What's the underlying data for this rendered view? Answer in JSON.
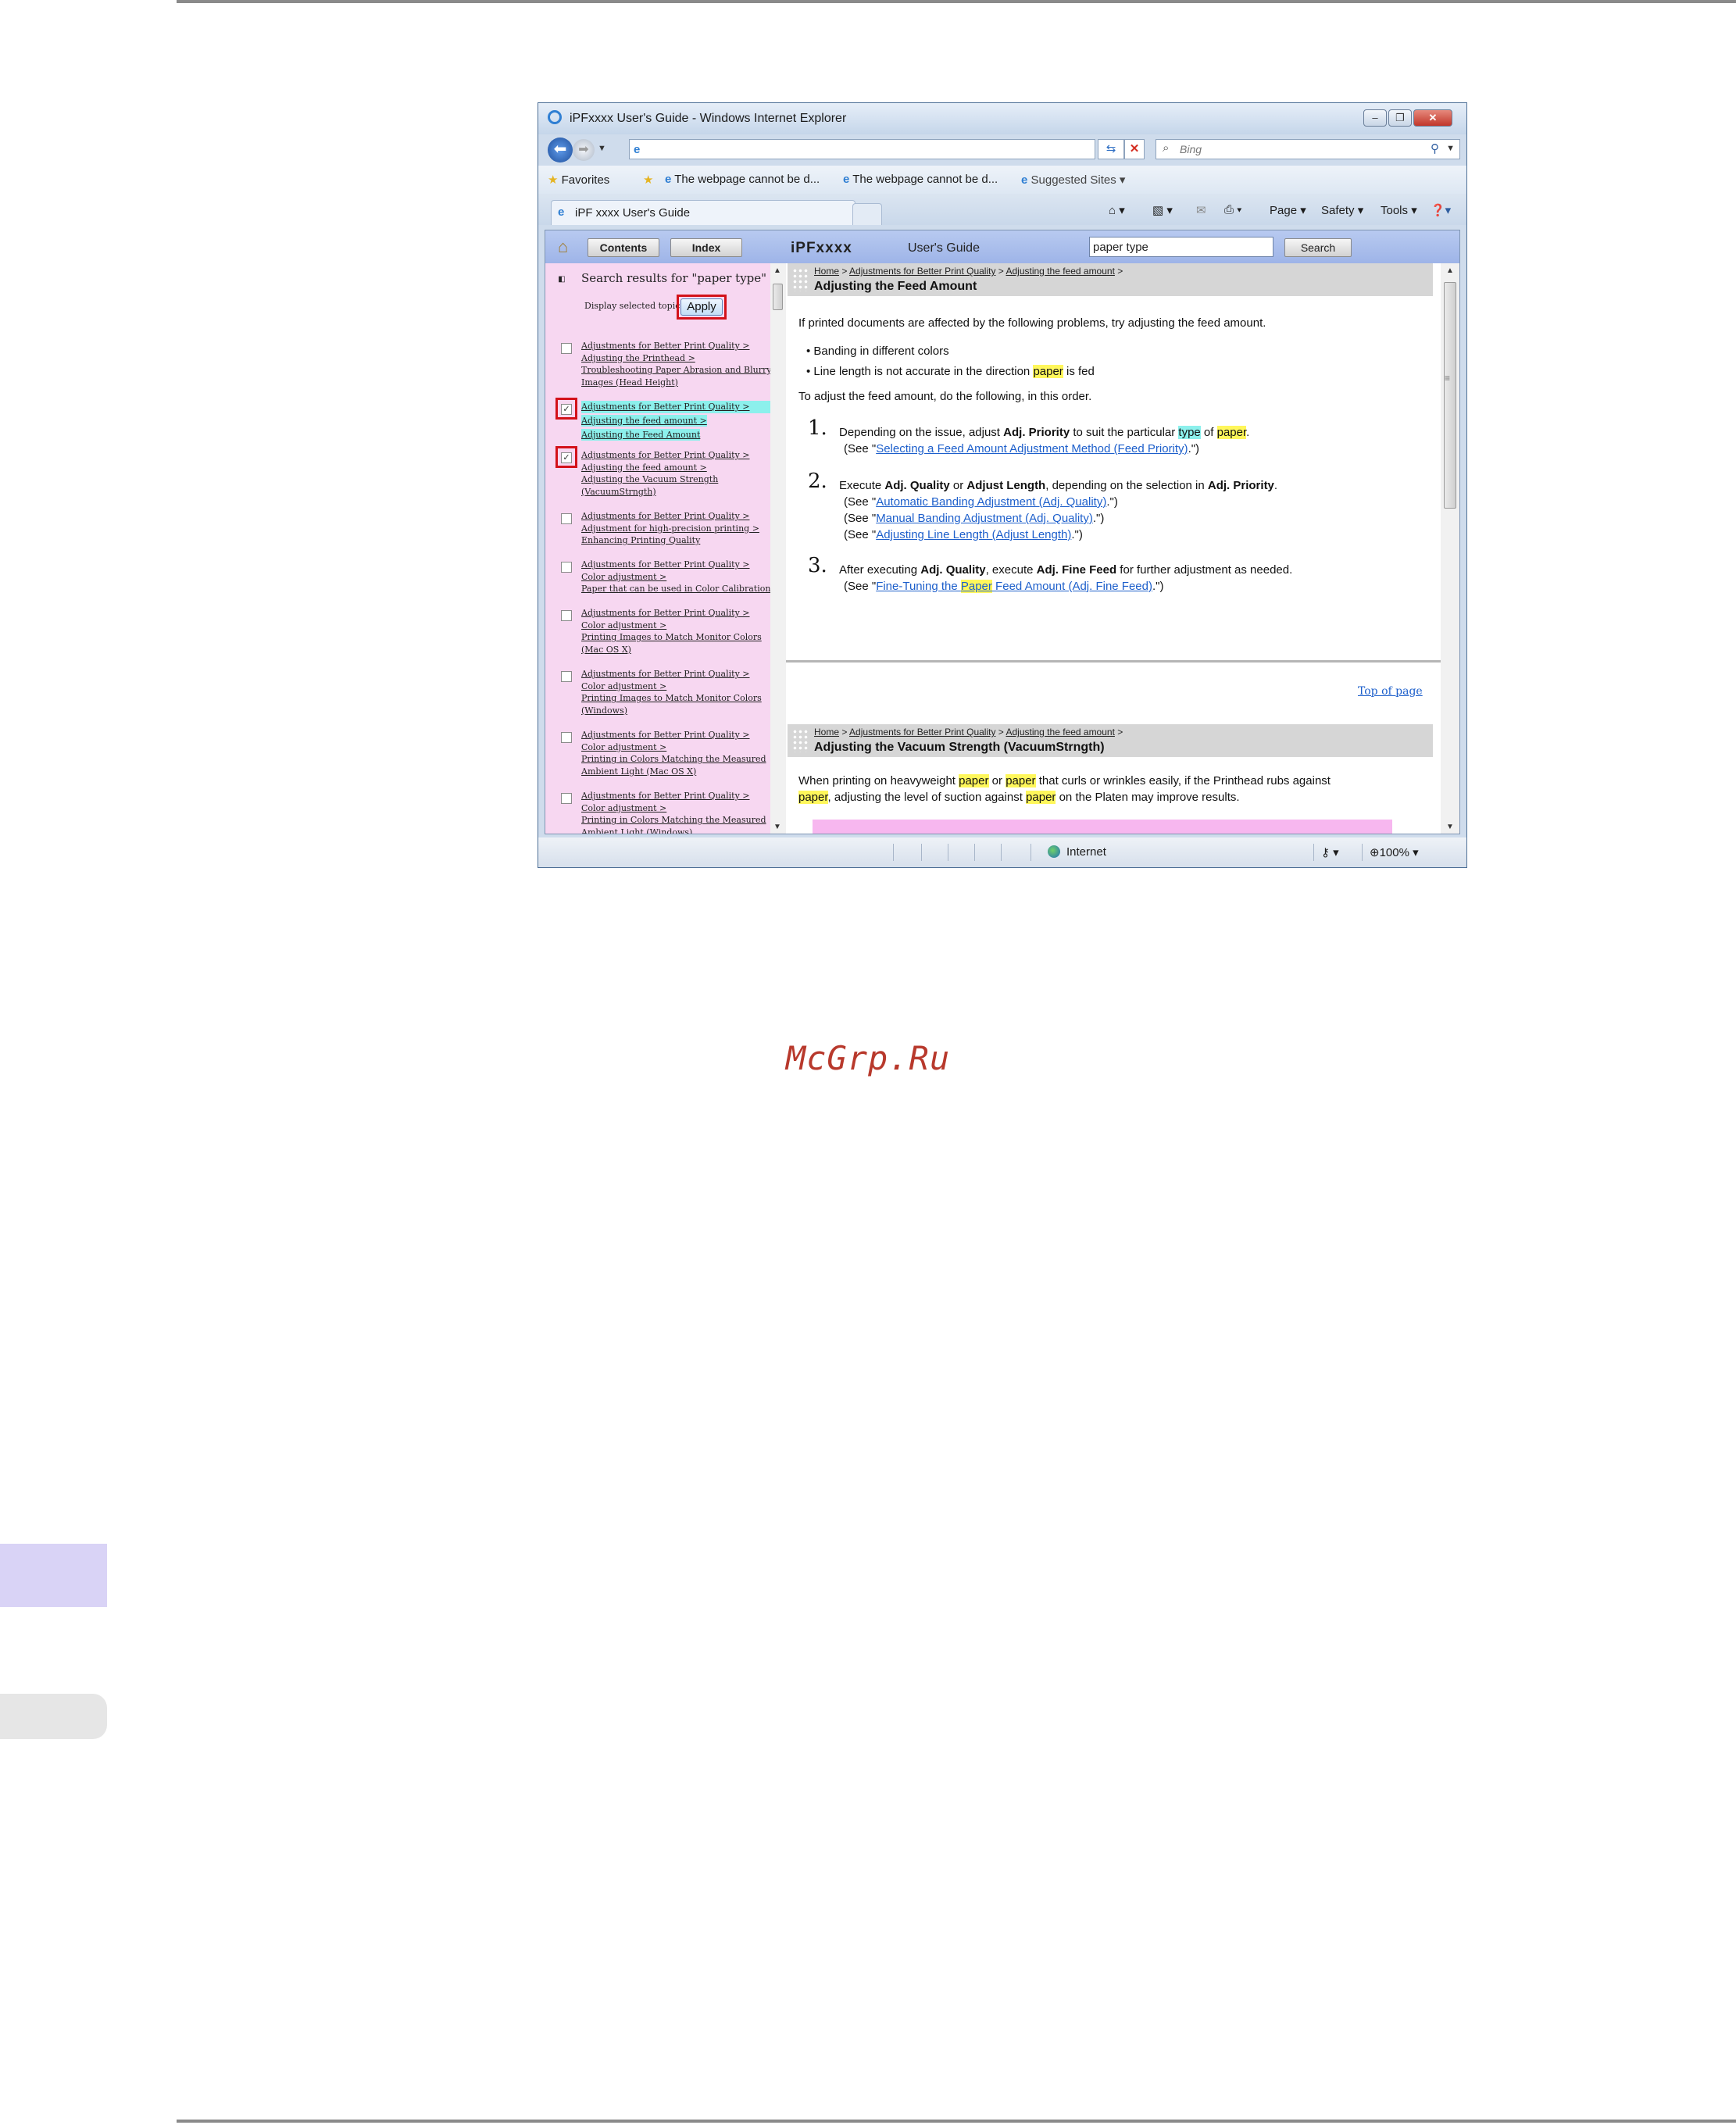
{
  "window": {
    "title": "iPFxxxx  User's Guide - Windows Internet Explorer",
    "search_placeholder": "Bing"
  },
  "favorites_bar": {
    "favorites_label": "Favorites",
    "items": [
      "The webpage cannot be d...",
      "The webpage cannot be d...",
      "Suggested Sites"
    ]
  },
  "tab": {
    "label": "iPF xxxx  User's Guide"
  },
  "command_bar": {
    "page": "Page",
    "safety": "Safety",
    "tools": "Tools"
  },
  "app": {
    "contents_button": "Contents",
    "index_button": "Index",
    "brand": "iPFxxxx",
    "guide_title": "User's Guide",
    "search_value": "paper type",
    "search_button": "Search"
  },
  "search_panel": {
    "heading": "Search results for \"paper type\"",
    "display_selected": "Display selected topic",
    "apply_button": "Apply",
    "results": [
      {
        "checked": false,
        "selected": false,
        "lines": [
          "Adjustments for Better Print Quality >",
          "Adjusting the Printhead >",
          "Troubleshooting Paper Abrasion and Blurry",
          "Images (Head Height)"
        ]
      },
      {
        "checked": true,
        "selected": true,
        "lines": [
          "Adjustments for Better Print Quality >",
          "Adjusting the feed amount >",
          "Adjusting the Feed Amount"
        ]
      },
      {
        "checked": true,
        "selected": false,
        "lines": [
          "Adjustments for Better Print Quality >",
          "Adjusting the feed amount >",
          "Adjusting the Vacuum Strength",
          "(VacuumStrngth)"
        ]
      },
      {
        "checked": false,
        "selected": false,
        "lines": [
          "Adjustments for Better Print Quality >",
          "Adjustment for high-precision printing >",
          "Enhancing Printing Quality"
        ]
      },
      {
        "checked": false,
        "selected": false,
        "lines": [
          "Adjustments for Better Print Quality >",
          "Color adjustment >",
          "Paper that can be used in Color Calibration"
        ]
      },
      {
        "checked": false,
        "selected": false,
        "lines": [
          "Adjustments for Better Print Quality >",
          "Color adjustment >",
          "Printing Images to Match Monitor Colors",
          "(Mac OS X)"
        ]
      },
      {
        "checked": false,
        "selected": false,
        "lines": [
          "Adjustments for Better Print Quality >",
          "Color adjustment >",
          "Printing Images to Match Monitor Colors",
          "(Windows)"
        ]
      },
      {
        "checked": false,
        "selected": false,
        "lines": [
          "Adjustments for Better Print Quality >",
          "Color adjustment >",
          "Printing in Colors Matching the Measured",
          "Ambient Light (Mac OS X)"
        ]
      },
      {
        "checked": false,
        "selected": false,
        "lines": [
          "Adjustments for Better Print Quality >",
          "Color adjustment >",
          "Printing in Colors Matching the Measured",
          "Ambient Light (Windows)"
        ]
      }
    ]
  },
  "section1": {
    "crumb_home": "Home",
    "crumb_sep": ">",
    "crumb_1": "Adjustments for Better Print Quality",
    "crumb_2": "Adjusting the feed amount",
    "title": "Adjusting the Feed Amount",
    "intro": "If printed documents are affected by the following problems, try adjusting the feed amount.",
    "bullet1": "Banding in different colors",
    "bullet2_a": "Line length is not accurate in the direction ",
    "bullet2_hl": "paper",
    "bullet2_b": " is fed",
    "order": "To adjust the feed amount, do the following, in this order.",
    "step1_num": "1.",
    "step1_a": "Depending on the issue, adjust ",
    "step1_b": "Adj. Priority",
    "step1_c": " to suit the particular ",
    "step1_hl1": "type",
    "step1_d": " of ",
    "step1_hl2": "paper",
    "step1_e": ".",
    "see_open": "(See \"",
    "see_close": ".\")",
    "step1_link": "Selecting a Feed Amount Adjustment Method (Feed Priority)",
    "step2_num": "2.",
    "step2_a": "Execute ",
    "step2_b": "Adj. Quality",
    "step2_c": " or ",
    "step2_d": "Adjust Length",
    "step2_e": ", depending on the selection in ",
    "step2_f": "Adj. Priority",
    "step2_g": ".",
    "step2_link1": "Automatic Banding Adjustment (Adj. Quality)",
    "step2_link2": "Manual Banding Adjustment (Adj. Quality)",
    "step2_link3": "Adjusting Line Length (Adjust Length)",
    "step3_num": "3.",
    "step3_a": "After executing ",
    "step3_b": "Adj. Quality",
    "step3_c": ", execute ",
    "step3_d": "Adj. Fine Feed",
    "step3_e": " for further adjustment as needed.",
    "step3_link_a": "Fine-Tuning the ",
    "step3_link_hl": "Paper",
    "step3_link_b": " Feed Amount (Adj. Fine Feed)",
    "top_of_page": "Top of page"
  },
  "section2": {
    "title": "Adjusting the Vacuum Strength (VacuumStrngth)",
    "l1_a": "When printing on heavyweight ",
    "l1_hl1": "paper",
    "l1_b": " or ",
    "l1_hl2": "paper",
    "l1_c": " that curls or wrinkles easily, if the Printhead rubs against",
    "l2_hl1": "paper",
    "l2_a": ", adjusting the level of suction against ",
    "l2_hl2": "paper",
    "l2_b": " on the Platen may improve results."
  },
  "status_bar": {
    "zone": "Internet",
    "zoom": "100%"
  },
  "watermark": "McGrp.Ru"
}
